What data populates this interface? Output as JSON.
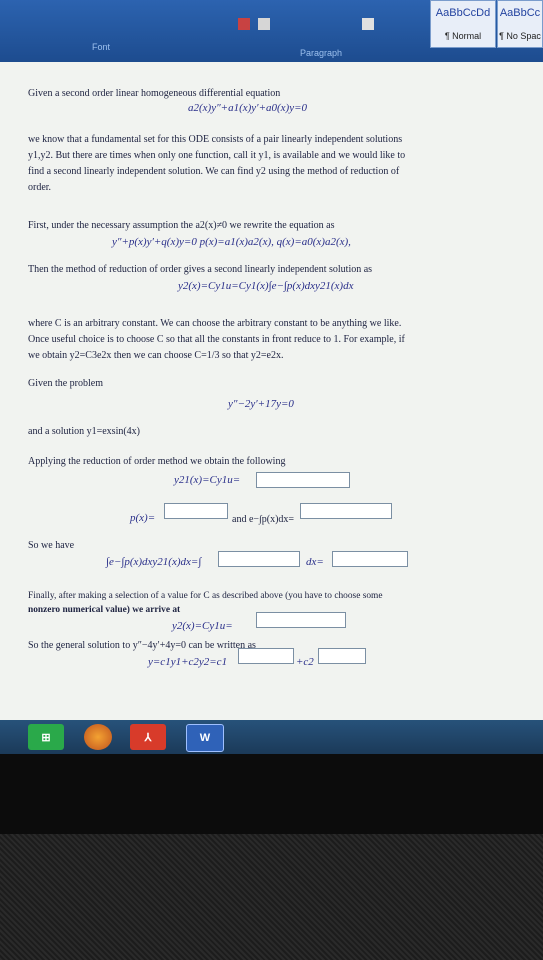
{
  "ribbon": {
    "style1": {
      "preview": "AaBbCcDd",
      "label": "¶ Normal"
    },
    "style2": {
      "preview": "AaBbCc",
      "label": "¶ No Spac"
    },
    "group_font": "Font",
    "group_paragraph": "Paragraph"
  },
  "document": {
    "p1": "Given a second order linear homogeneous differential equation",
    "eq1": "a2(x)y″+a1(x)y′+a0(x)y=0",
    "p2a": "we know that a fundamental set for this ODE consists of a pair linearly independent solutions",
    "p2b": "y1,y2. But there are times when only one function, call it y1, is available and we would like to",
    "p2c": "find a second linearly independent solution. We can find y2 using the method of reduction of",
    "p2d": "order.",
    "p3": "First, under the necessary assumption the a2(x)≠0 we rewrite the equation as",
    "eq2": "y″+p(x)y′+q(x)y=0   p(x)=a1(x)a2(x),  q(x)=a0(x)a2(x),",
    "p4": "Then the method of reduction of order gives a second linearly independent solution as",
    "eq3": "y2(x)=Cy1u=Cy1(x)∫e−∫p(x)dxy21(x)dx",
    "p5a": "where C is an arbitrary constant. We can choose the arbitrary constant to be anything we like.",
    "p5b": "Once useful choice is to choose C so that all the constants in front reduce to 1. For example, if",
    "p5c": "we obtain y2=C3e2x then we can choose C=1/3 so that y2=e2x.",
    "p6": "Given the problem",
    "eq4": "y″−2y′+17y=0",
    "p7": "and a solution y1=exsin(4x)",
    "p8": "Applying the reduction of order method we obtain the following",
    "eq5": "y21(x)=Cy1u=",
    "eq6a": "p(x)=",
    "eq6b": "and e−∫p(x)dx=",
    "p9": "So we have",
    "eq7a": "∫e−∫p(x)dxy21(x)dx=∫",
    "eq7b": "dx=",
    "p10a": "Finally, after making a selection of a value for C as described above (you have to choose some",
    "p10b": "nonzero numerical value) we arrive at",
    "eq8": "y2(x)=Cy1u=",
    "p11": "So the general solution to y″−4y′+4y=0 can be written as",
    "eq9a": "y=c1y1+c2y2=c1",
    "eq9b": "+c2"
  },
  "taskbar": {
    "word_label": "W"
  },
  "colors": {
    "ribbon": "#1d4c8f",
    "page": "#f1f3f0",
    "taskbar": "#1b3a59"
  }
}
